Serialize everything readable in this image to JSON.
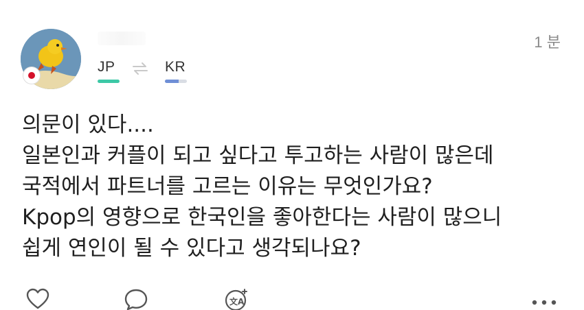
{
  "post": {
    "time": "1 분",
    "languages": {
      "from": "JP",
      "to": "KR"
    },
    "lines": [
      "의문이 있다....",
      "일본인과 커플이 되고 싶다고 투고하는 사람이 많은데",
      "국적에서 파트너를 고르는 이유는 무엇인가요?",
      "Kpop의 영향으로 한국인을 좋아한다는 사람이 많으니",
      "쉽게 연인이 될 수 있다고 생각되나요?"
    ]
  },
  "icons": {
    "avatar": "duck-avatar",
    "flag": "japan-flag-icon",
    "swap": "swap-arrows-icon",
    "like": "heart-icon",
    "comment": "comment-bubble-icon",
    "translate": "translate-icon",
    "more": "more-dots-icon"
  },
  "colors": {
    "jp_bar": "#3dc8a6",
    "kr_bar": "#6f8fd6",
    "flag_red": "#d4122b"
  }
}
